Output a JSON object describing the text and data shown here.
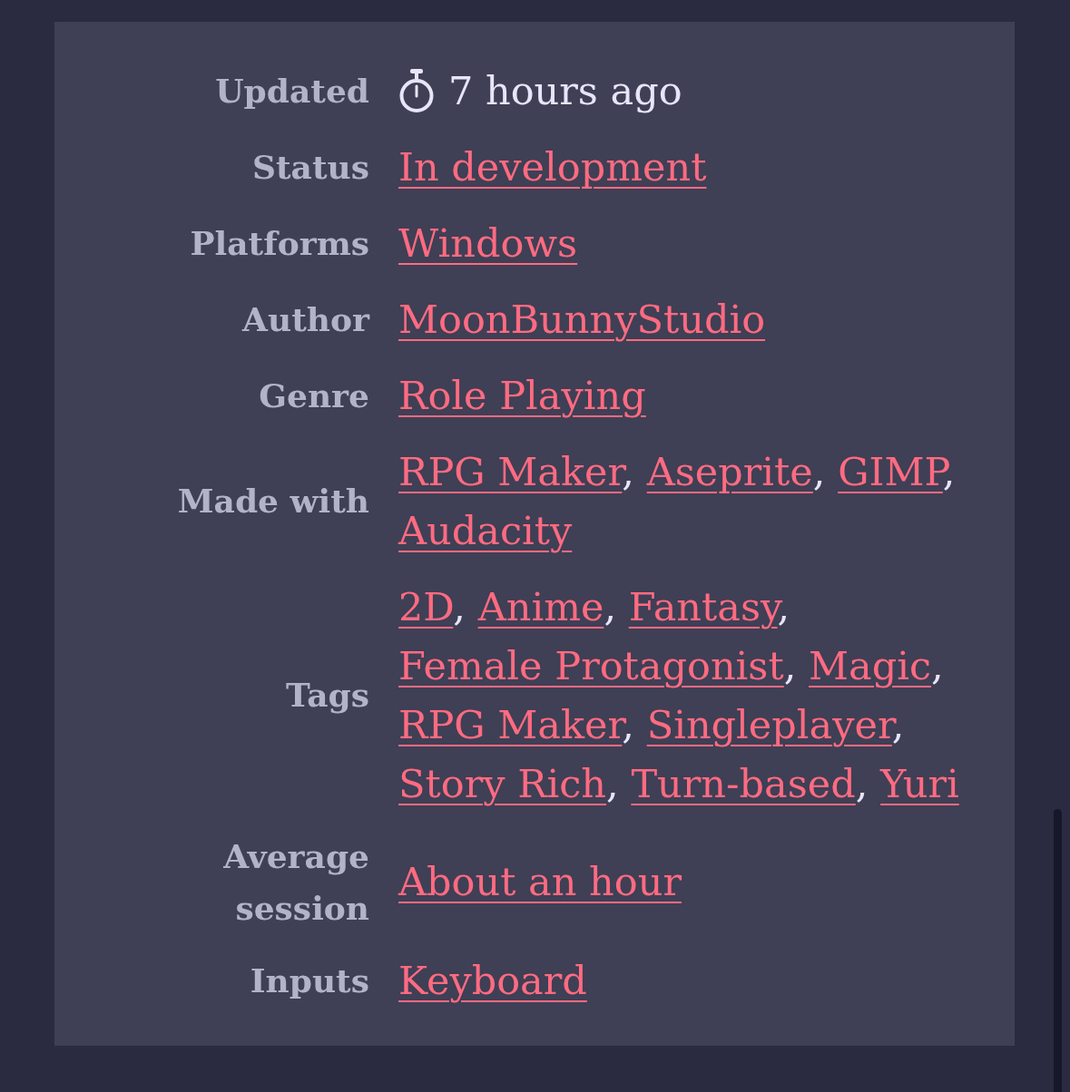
{
  "details": [
    {
      "kind": "time",
      "label": "Updated",
      "value": "7 hours ago"
    },
    {
      "kind": "links",
      "label": "Status",
      "links": [
        "In development"
      ]
    },
    {
      "kind": "links",
      "label": "Platforms",
      "links": [
        "Windows"
      ]
    },
    {
      "kind": "links",
      "label": "Author",
      "links": [
        "MoonBunnyStudio"
      ]
    },
    {
      "kind": "links",
      "label": "Genre",
      "links": [
        "Role Playing"
      ]
    },
    {
      "kind": "links",
      "label": "Made with",
      "links": [
        "RPG Maker",
        "Aseprite",
        "GIMP",
        "Audacity"
      ],
      "separator": ","
    },
    {
      "kind": "links",
      "label": "Tags",
      "links": [
        "2D",
        "Anime",
        "Fantasy",
        "Female Protagonist",
        "Magic",
        "RPG Maker",
        "Singleplayer",
        "Story Rich",
        "Turn-based",
        "Yuri"
      ],
      "separator": ","
    },
    {
      "kind": "links",
      "label": "Average session",
      "links": [
        "About an hour"
      ]
    },
    {
      "kind": "links",
      "label": "Inputs",
      "links": [
        "Keyboard"
      ]
    }
  ]
}
